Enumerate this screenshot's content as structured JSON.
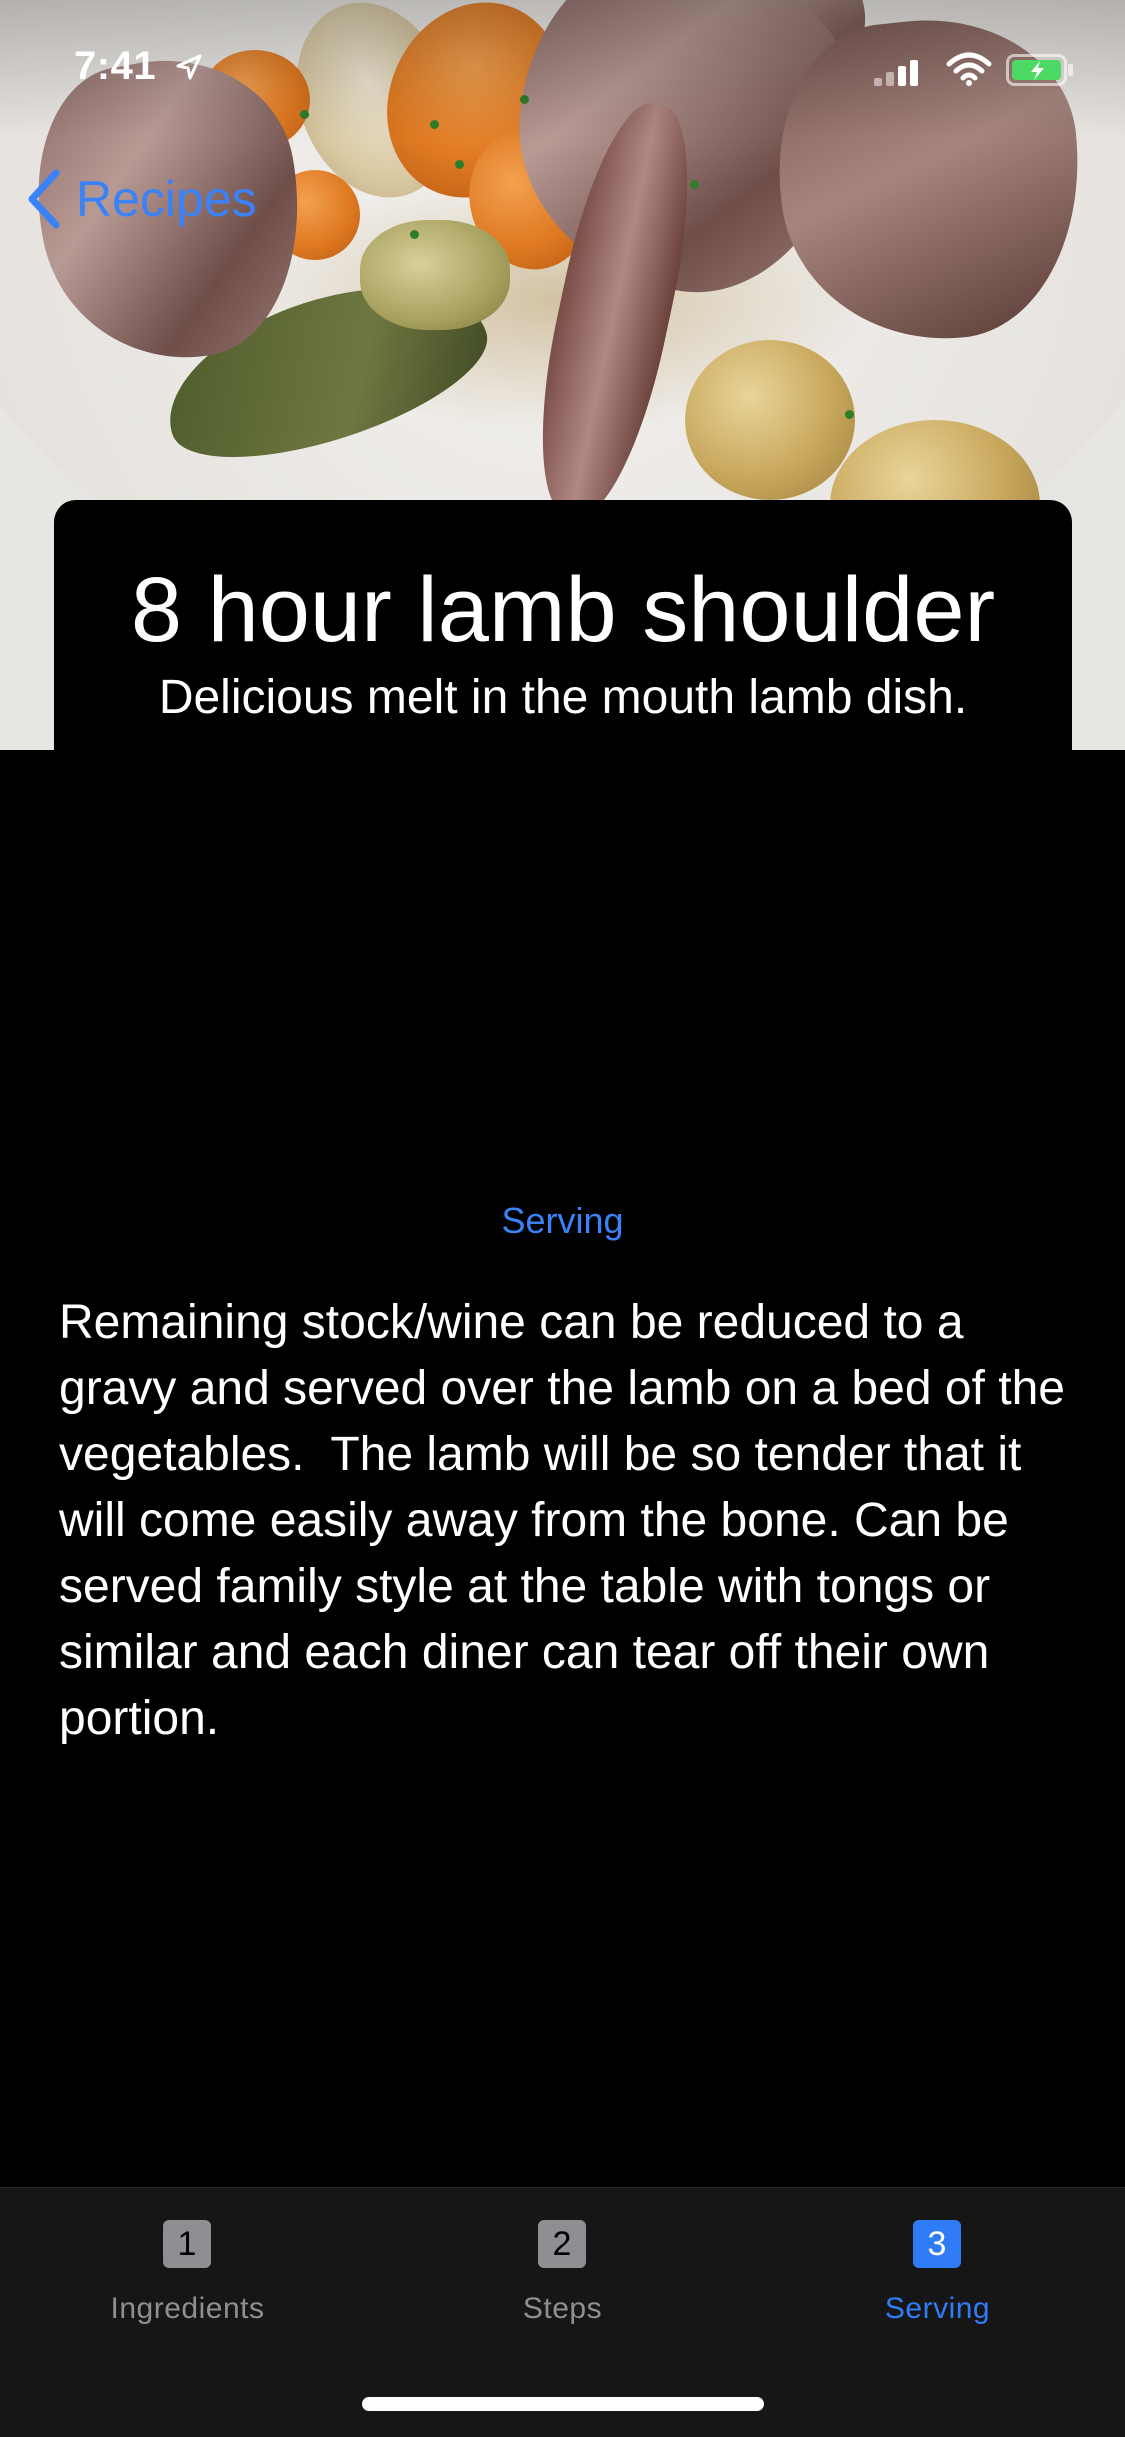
{
  "status_bar": {
    "time": "7:41",
    "icons": [
      "location-icon",
      "signal-icon",
      "wifi-icon",
      "battery-icon"
    ]
  },
  "nav": {
    "back_label": "Recipes",
    "back_icon": "chevron-left-icon"
  },
  "recipe": {
    "title": "8 hour lamb shoulder",
    "subtitle": "Delicious melt in the mouth lamb dish."
  },
  "section": {
    "heading": "Serving",
    "body": "Remaining stock/wine can be reduced to a gravy and served over the lamb on a bed of the vegetables.  The lamb will be so tender that it will come easily away from the bone. Can be served family style at the table with tongs or similar and each diner can tear off their own portion."
  },
  "tabs": [
    {
      "number": "1",
      "label": "Ingredients",
      "active": false
    },
    {
      "number": "2",
      "label": "Steps",
      "active": false
    },
    {
      "number": "3",
      "label": "Serving",
      "active": true
    }
  ],
  "colors": {
    "accent": "#3a82f7",
    "background": "#000000",
    "tab_bar": "#161616",
    "tab_inactive": "#8e8e93"
  }
}
